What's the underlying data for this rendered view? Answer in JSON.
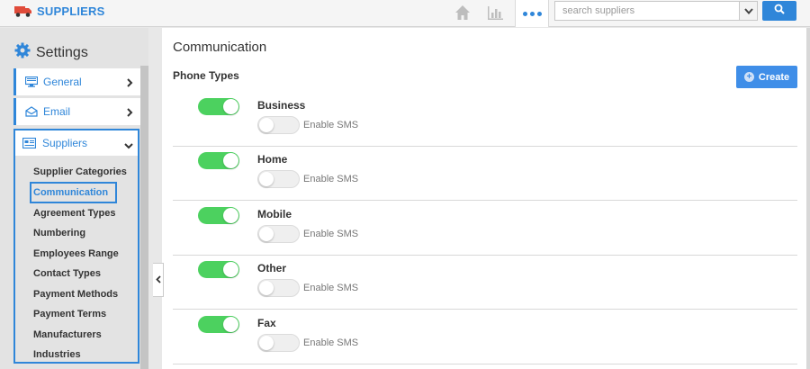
{
  "app": {
    "title": "SUPPLIERS"
  },
  "colors": {
    "accent": "#2f86d9",
    "toggle_on": "#4cd15f",
    "create_button": "#3f8ee8"
  },
  "icons": {
    "brand": "truck-icon",
    "home": "home-icon",
    "chart": "bar-chart-icon",
    "more": "more-dots-icon",
    "search": "search-icon",
    "settings": "gear-icon",
    "general": "monitor-icon",
    "email": "envelope-icon",
    "suppliers": "list-card-icon"
  },
  "search": {
    "placeholder": "search suppliers",
    "value": ""
  },
  "sidebar": {
    "title": "Settings",
    "items": [
      {
        "label": "General",
        "expanded": false
      },
      {
        "label": "Email",
        "expanded": false
      },
      {
        "label": "Suppliers",
        "expanded": true
      }
    ],
    "submenu": [
      "Supplier Categories",
      "Communication",
      "Agreement Types",
      "Numbering",
      "Employees Range",
      "Contact Types",
      "Payment Methods",
      "Payment Terms",
      "Manufacturers",
      "Industries"
    ],
    "active_submenu": "Communication"
  },
  "main": {
    "title": "Communication",
    "section": "Phone Types",
    "create_label": "Create",
    "sms_label": "Enable SMS",
    "phone_types": [
      {
        "name": "Business",
        "enabled": true,
        "sms": false
      },
      {
        "name": "Home",
        "enabled": true,
        "sms": false
      },
      {
        "name": "Mobile",
        "enabled": true,
        "sms": false
      },
      {
        "name": "Other",
        "enabled": true,
        "sms": false
      },
      {
        "name": "Fax",
        "enabled": true,
        "sms": false
      }
    ]
  }
}
